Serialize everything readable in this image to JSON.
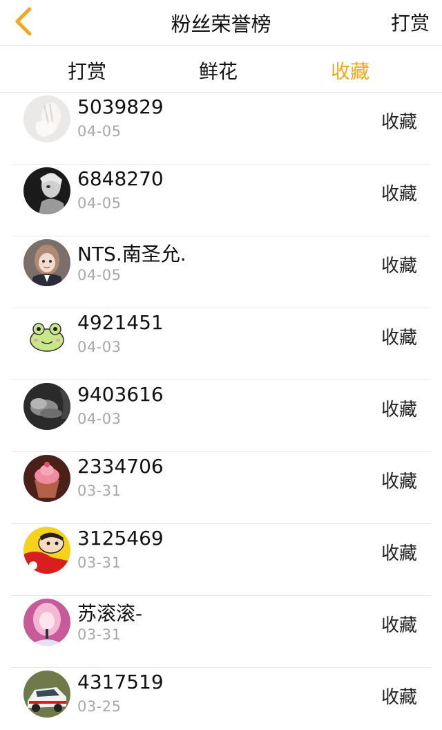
{
  "nav": {
    "title": "粉丝荣誉榜",
    "right_label": "打赏",
    "back_icon": "chevron-left-icon",
    "accent": "#f3a81c"
  },
  "tabs": [
    {
      "label": "打赏",
      "active": false
    },
    {
      "label": "鲜花",
      "active": false
    },
    {
      "label": "收藏",
      "active": true
    }
  ],
  "list": [
    {
      "name": "5039829",
      "date": "04-05",
      "action": "收藏",
      "avatar": "avatar-hand"
    },
    {
      "name": "6848270",
      "date": "04-05",
      "action": "收藏",
      "avatar": "avatar-bw-portrait"
    },
    {
      "name": "NTS.南圣允.",
      "date": "04-05",
      "action": "收藏",
      "avatar": "avatar-girl-uniform"
    },
    {
      "name": "4921451",
      "date": "04-03",
      "action": "收藏",
      "avatar": "avatar-frog"
    },
    {
      "name": "9403616",
      "date": "04-03",
      "action": "收藏",
      "avatar": "avatar-smoke"
    },
    {
      "name": "2334706",
      "date": "03-31",
      "action": "收藏",
      "avatar": "avatar-cupcake"
    },
    {
      "name": "3125469",
      "date": "03-31",
      "action": "收藏",
      "avatar": "avatar-cartoon-boy"
    },
    {
      "name": "苏滚滚-",
      "date": "03-31",
      "action": "收藏",
      "avatar": "avatar-pink-singer"
    },
    {
      "name": "4317519",
      "date": "03-25",
      "action": "收藏",
      "avatar": "avatar-race-car"
    }
  ]
}
